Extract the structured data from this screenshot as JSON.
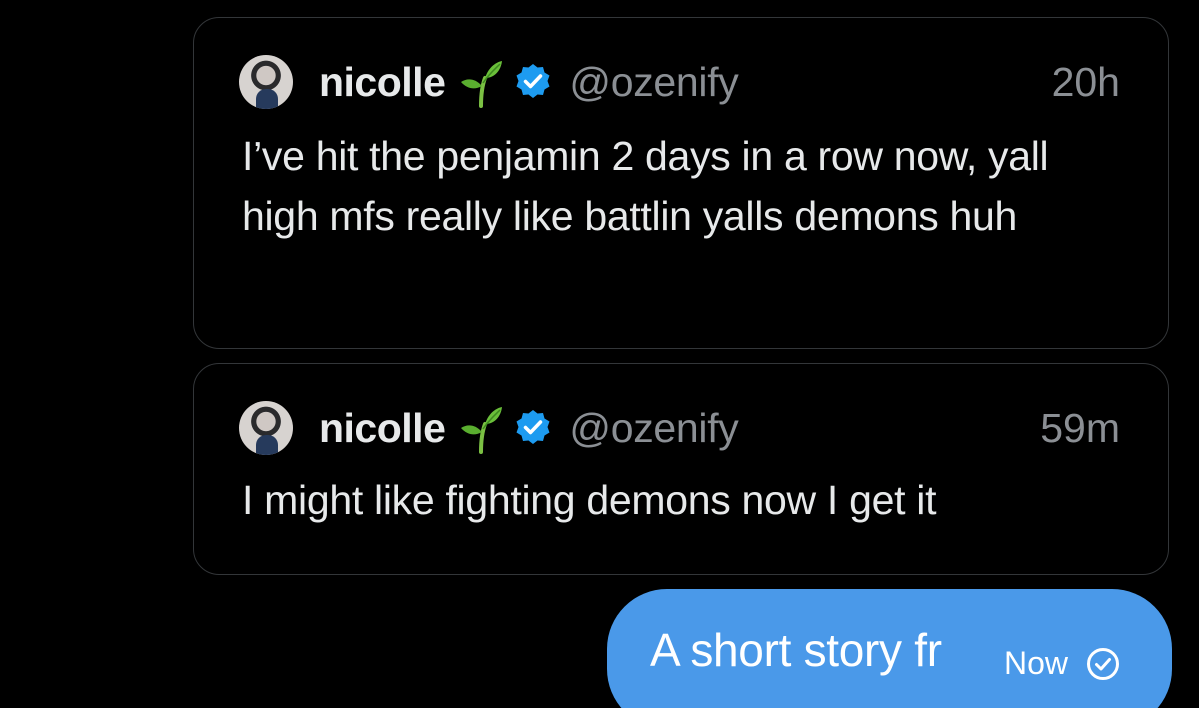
{
  "quoted_tweets": [
    {
      "display_name": "nicolle",
      "handle": "@ozenify",
      "timestamp": "20h",
      "text": "I’ve hit the penjamin 2 days in a row now, yall high mfs really like battlin yalls demons huh"
    },
    {
      "display_name": "nicolle",
      "handle": "@ozenify",
      "timestamp": "59m",
      "text": "I might like fighting demons now I get it"
    }
  ],
  "message": {
    "text": "A short story fr",
    "time": "Now"
  },
  "icons": {
    "emoji": "sprout-icon",
    "verified": "verified-badge-icon",
    "status": "sent-check-icon"
  },
  "colors": {
    "background": "#000000",
    "bubble": "#4a99e9",
    "verified": "#1d9bf0",
    "muted_text": "#8b8f94"
  }
}
